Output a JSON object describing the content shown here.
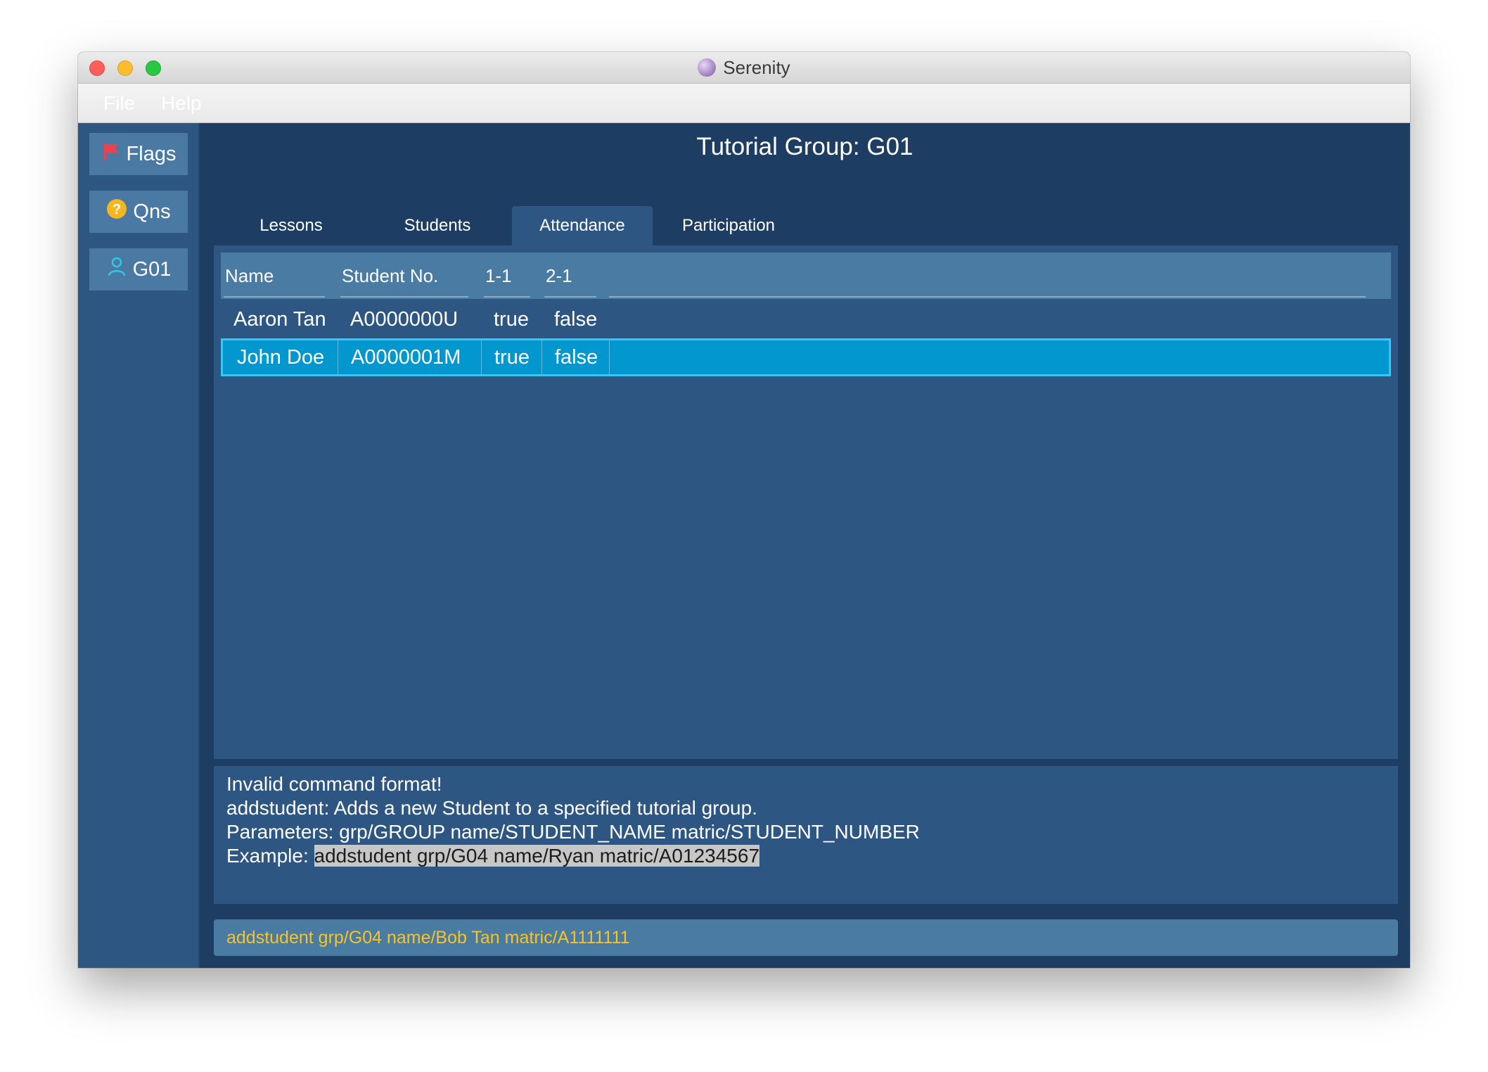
{
  "window": {
    "title": "Serenity",
    "app_icon": "serenity-app-icon"
  },
  "menu": {
    "items": [
      "File",
      "Help"
    ]
  },
  "sidebar": {
    "items": [
      {
        "label": "Flags",
        "icon": "flag-icon",
        "icon_color": "#e8434f"
      },
      {
        "label": "Qns",
        "icon": "question-icon",
        "icon_color": "#f5b71d"
      },
      {
        "label": "G01",
        "icon": "person-icon",
        "icon_color": "#33c8e0"
      }
    ]
  },
  "header": {
    "title": "Tutorial Group: G01"
  },
  "tabs": [
    {
      "label": "Lessons",
      "active": false
    },
    {
      "label": "Students",
      "active": false
    },
    {
      "label": "Attendance",
      "active": true
    },
    {
      "label": "Participation",
      "active": false
    }
  ],
  "table": {
    "columns": [
      "Name",
      "Student No.",
      "1-1",
      "2-1"
    ],
    "rows": [
      {
        "cells": [
          "Aaron Tan",
          "A0000000U",
          "true",
          "false"
        ],
        "selected": false
      },
      {
        "cells": [
          "John Doe",
          "A0000001M",
          "true",
          "false"
        ],
        "selected": true
      }
    ]
  },
  "result": {
    "lines": [
      "Invalid command format!",
      "addstudent: Adds a new Student to a specified tutorial group.",
      "Parameters: grp/GROUP name/STUDENT_NAME matric/STUDENT_NUMBER"
    ],
    "example_prefix": "Example: ",
    "example_highlight": "addstudent grp/G04 name/Ryan matric/A01234567"
  },
  "command": {
    "value": "addstudent grp/G04 name/Bob Tan matric/A1111111"
  },
  "colors": {
    "main_bg": "#1e3d63",
    "panel_bg": "#2d5782",
    "header_bg": "#4a7ba3",
    "selected_row": "#0297cf",
    "command_text": "#f7c325"
  }
}
